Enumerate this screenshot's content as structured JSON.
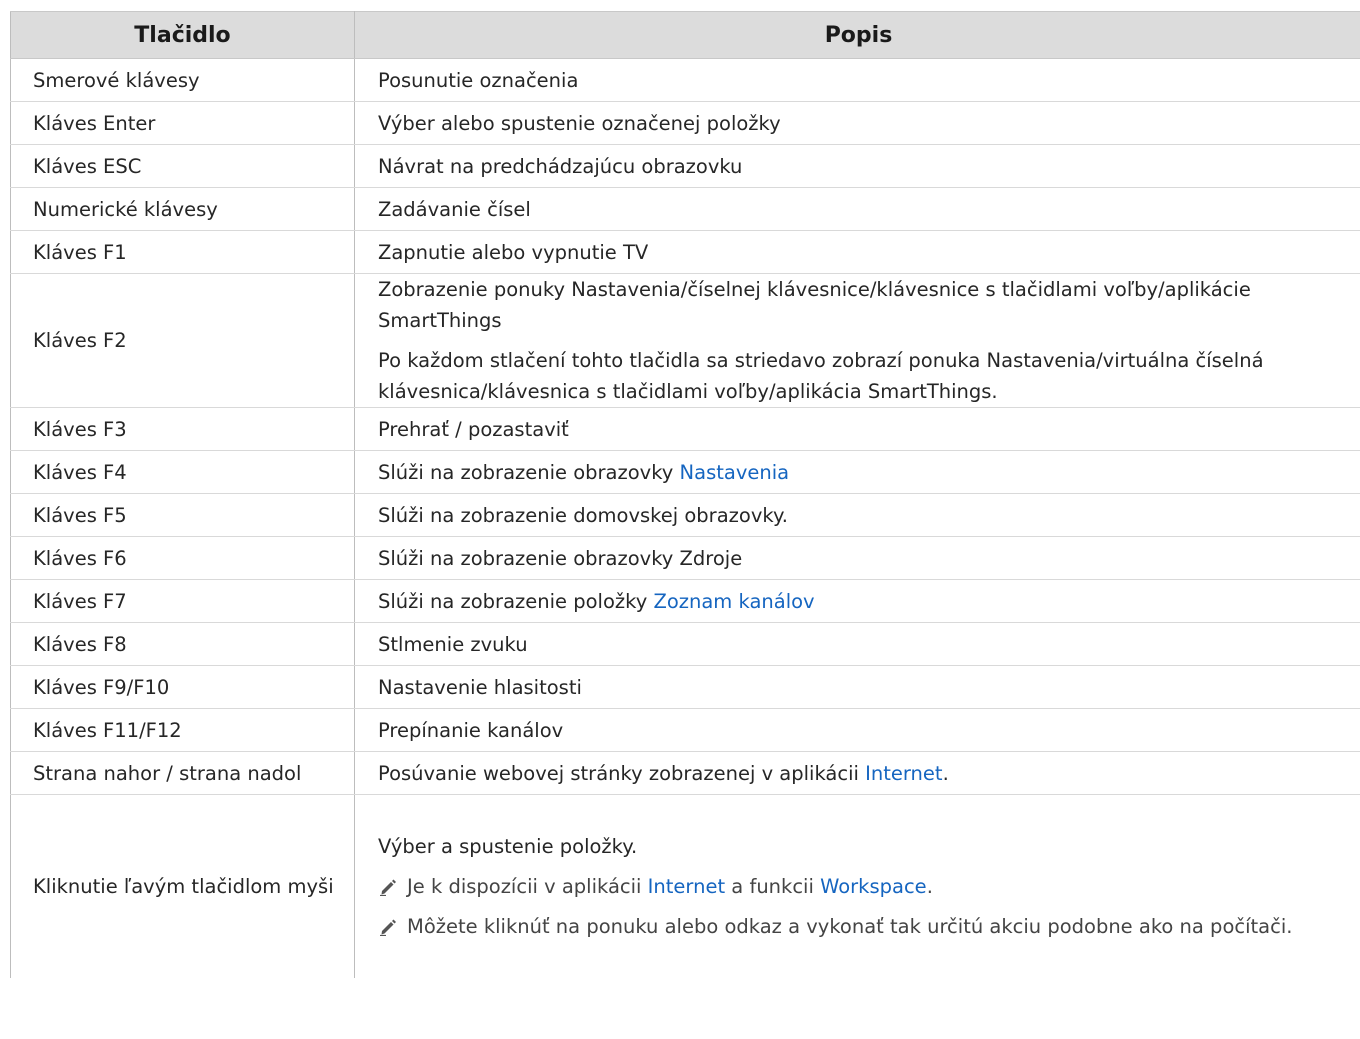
{
  "header": {
    "col1": "Tlačidlo",
    "col2": "Popis"
  },
  "rows": [
    {
      "key": "Smerové klávesy",
      "desc": "Posunutie označenia"
    },
    {
      "key": "Kláves Enter",
      "desc": "Výber alebo spustenie označenej položky"
    },
    {
      "key": "Kláves ESC",
      "desc": "Návrat na predchádzajúcu obrazovku"
    },
    {
      "key": "Numerické klávesy",
      "desc": "Zadávanie čísel"
    },
    {
      "key": "Kláves F1",
      "desc": "Zapnutie alebo vypnutie TV"
    },
    {
      "key": "Kláves F2",
      "desc": "Zobrazenie ponuky Nastavenia/číselnej klávesnice/klávesnice s tlačidlami voľby/aplikácie SmartThings",
      "desc2": "Po každom stlačení tohto tlačidla sa striedavo zobrazí ponuka Nastavenia/virtuálna číselná klávesnica/klávesnica s tlačidlami voľby/aplikácia SmartThings."
    },
    {
      "key": "Kláves F3",
      "desc": "Prehrať / pozastaviť"
    },
    {
      "key": "Kláves F4",
      "desc_prefix": "Slúži na zobrazenie obrazovky ",
      "desc_link": "Nastavenia"
    },
    {
      "key": "Kláves F5",
      "desc": "Slúži na zobrazenie domovskej obrazovky."
    },
    {
      "key": "Kláves F6",
      "desc": "Slúži na zobrazenie obrazovky Zdroje"
    },
    {
      "key": "Kláves F7",
      "desc_prefix": "Slúži na zobrazenie položky ",
      "desc_link": "Zoznam kanálov"
    },
    {
      "key": "Kláves F8",
      "desc": "Stlmenie zvuku"
    },
    {
      "key": "Kláves F9/F10",
      "desc": "Nastavenie hlasitosti"
    },
    {
      "key": "Kláves F11/F12",
      "desc": "Prepínanie kanálov"
    },
    {
      "key": "Strana nahor / strana nadol",
      "desc_prefix": "Posúvanie webovej stránky zobrazenej v aplikácii ",
      "desc_link": "Internet",
      "desc_suffix": "."
    },
    {
      "key": "Kliknutie ľavým tlačidlom myši",
      "desc": "Výber a spustenie položky.",
      "note1_prefix": "Je k dispozícii v aplikácii ",
      "note1_link1": "Internet",
      "note1_mid": " a funkcii ",
      "note1_link2": "Workspace",
      "note1_suffix": ".",
      "note2": "Môžete kliknúť na ponuku alebo odkaz a vykonať tak určitú akciu podobne ako na počítači."
    }
  ],
  "icons": {
    "note": "pencil-icon"
  },
  "colors": {
    "link": "#1565c0",
    "header_bg": "#dcdcdc"
  }
}
